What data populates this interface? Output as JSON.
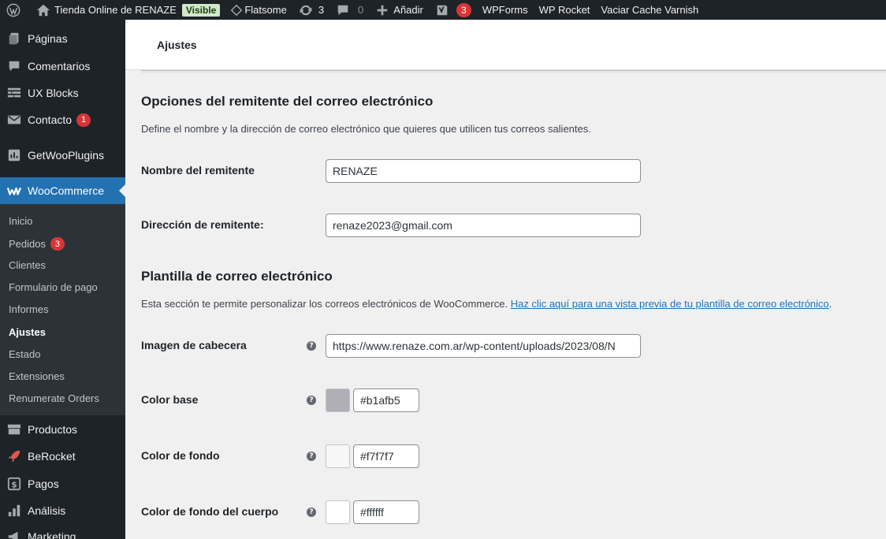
{
  "adminbar": {
    "site_name": "Tienda Online de RENAZE",
    "visible_badge": "Visible",
    "theme": "Flatsome",
    "updates_count": "3",
    "comments_count": "0",
    "add_new": "Añadir",
    "yoast_count": "3",
    "wpforms": "WPForms",
    "wprocket": "WP Rocket",
    "varnish": "Vaciar Cache Varnish"
  },
  "sidebar": {
    "items": [
      {
        "label": "Páginas",
        "icon": "pages-icon"
      },
      {
        "label": "Comentarios",
        "icon": "comments-icon"
      },
      {
        "label": "UX Blocks",
        "icon": "ux-blocks-icon"
      },
      {
        "label": "Contacto",
        "icon": "mail-icon",
        "badge": "1"
      },
      {
        "label": "GetWooPlugins",
        "icon": "plugins-icon"
      },
      {
        "label": "WooCommerce",
        "icon": "woocommerce-icon"
      },
      {
        "label": "Productos",
        "icon": "products-icon"
      },
      {
        "label": "BeRocket",
        "icon": "rocket-icon"
      },
      {
        "label": "Pagos",
        "icon": "payments-icon"
      },
      {
        "label": "Análisis",
        "icon": "analytics-icon"
      },
      {
        "label": "Marketing",
        "icon": "megaphone-icon"
      }
    ],
    "submenu": [
      {
        "label": "Inicio"
      },
      {
        "label": "Pedidos",
        "badge": "3"
      },
      {
        "label": "Clientes"
      },
      {
        "label": "Formulario de pago"
      },
      {
        "label": "Informes"
      },
      {
        "label": "Ajustes"
      },
      {
        "label": "Estado"
      },
      {
        "label": "Extensiones"
      },
      {
        "label": "Renumerate Orders"
      }
    ]
  },
  "top": {
    "tab_label": "Ajustes"
  },
  "sender": {
    "heading": "Opciones del remitente del correo electrónico",
    "description": "Define el nombre y la dirección de correo electrónico que quieres que utilicen tus correos salientes.",
    "name_label": "Nombre del remitente",
    "name_value": "RENAZE",
    "address_label": "Dirección de remitente:",
    "address_value": "renaze2023@gmail.com"
  },
  "template": {
    "heading": "Plantilla de correo electrónico",
    "description": "Esta sección te permite personalizar los correos electrónicos de WooCommerce.",
    "preview_link": "Haz clic aquí para una vista previa de tu plantilla de correo electrónico",
    "period": ".",
    "header_image_label": "Imagen de cabecera",
    "header_image_value": "https://www.renaze.com.ar/wp-content/uploads/2023/08/N",
    "base_color_label": "Color base",
    "base_color_value": "#b1afb5",
    "bg_color_label": "Color de fondo",
    "bg_color_value": "#f7f7f7",
    "body_bg_label": "Color de fondo del cuerpo",
    "body_bg_value": "#ffffff"
  },
  "colors": {
    "admin_bg": "#1d2327",
    "accent": "#2271b1",
    "badge_red": "#d63638",
    "swatch_base": "#b1afb5",
    "swatch_bg": "#f7f7f7",
    "swatch_body": "#ffffff"
  }
}
